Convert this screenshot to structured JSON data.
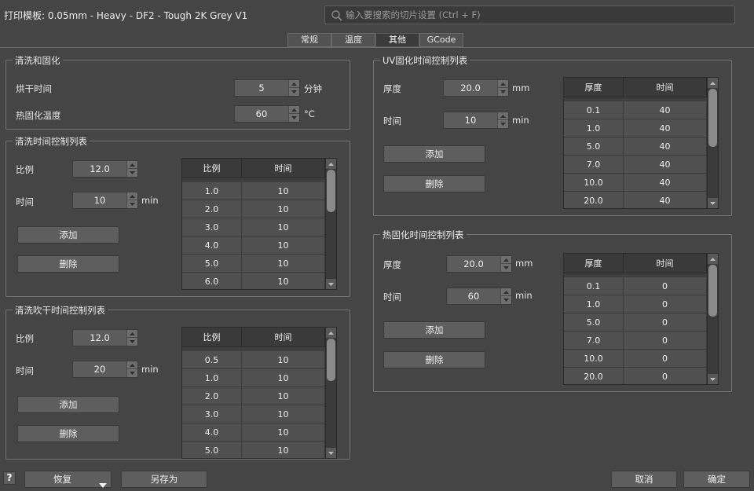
{
  "title": "打印模板: 0.05mm - Heavy - DF2 - Tough 2K Grey V1",
  "search": {
    "placeholder": "输入要搜索的切片设置 (Ctrl + F)"
  },
  "tabs": [
    {
      "label": "常规"
    },
    {
      "label": "温度"
    },
    {
      "label": "其他",
      "active": true
    },
    {
      "label": "GCode"
    }
  ],
  "wash_cure": {
    "title": "清洗和固化",
    "dry_time": {
      "label": "烘干时间",
      "value": "5",
      "unit": "分钟"
    },
    "heat_temp": {
      "label": "热固化温度",
      "value": "60",
      "unit": "°C"
    }
  },
  "wash_time_list": {
    "title": "清洗时间控制列表",
    "ratio": {
      "label": "比例",
      "value": "12.0"
    },
    "time": {
      "label": "时间",
      "value": "10",
      "unit": "min"
    },
    "add_label": "添加",
    "delete_label": "删除",
    "headers": [
      "比例",
      "时间"
    ],
    "rows": [
      [
        "1.0",
        "10"
      ],
      [
        "2.0",
        "10"
      ],
      [
        "3.0",
        "10"
      ],
      [
        "4.0",
        "10"
      ],
      [
        "5.0",
        "10"
      ],
      [
        "6.0",
        "10"
      ]
    ]
  },
  "blow_time_list": {
    "title": "清洗吹干时间控制列表",
    "ratio": {
      "label": "比例",
      "value": "12.0"
    },
    "time": {
      "label": "时间",
      "value": "20",
      "unit": "min"
    },
    "add_label": "添加",
    "delete_label": "删除",
    "headers": [
      "比例",
      "时间"
    ],
    "rows": [
      [
        "0.5",
        "10"
      ],
      [
        "1.0",
        "10"
      ],
      [
        "2.0",
        "10"
      ],
      [
        "3.0",
        "10"
      ],
      [
        "4.0",
        "10"
      ],
      [
        "5.0",
        "10"
      ]
    ]
  },
  "uv_time_list": {
    "title": "UV固化时间控制列表",
    "thickness": {
      "label": "厚度",
      "value": "20.0",
      "unit": "mm"
    },
    "time": {
      "label": "时间",
      "value": "10",
      "unit": "min"
    },
    "add_label": "添加",
    "delete_label": "删除",
    "headers": [
      "厚度",
      "时间"
    ],
    "rows": [
      [
        "0.1",
        "40"
      ],
      [
        "1.0",
        "40"
      ],
      [
        "5.0",
        "40"
      ],
      [
        "7.0",
        "40"
      ],
      [
        "10.0",
        "40"
      ],
      [
        "20.0",
        "40"
      ]
    ]
  },
  "heat_time_list": {
    "title": "热固化时间控制列表",
    "thickness": {
      "label": "厚度",
      "value": "20.0",
      "unit": "mm"
    },
    "time": {
      "label": "时间",
      "value": "60",
      "unit": "min"
    },
    "add_label": "添加",
    "delete_label": "删除",
    "headers": [
      "厚度",
      "时间"
    ],
    "rows": [
      [
        "0.1",
        "0"
      ],
      [
        "1.0",
        "0"
      ],
      [
        "5.0",
        "0"
      ],
      [
        "7.0",
        "0"
      ],
      [
        "10.0",
        "0"
      ],
      [
        "20.0",
        "0"
      ]
    ]
  },
  "footer": {
    "help": "?",
    "restore_label": "恢复",
    "save_as_label": "另存为",
    "cancel_label": "取消",
    "ok_label": "确定"
  },
  "colors": {
    "background": "#454545",
    "table_row": "#505050",
    "table_header": "#3a3a3a",
    "button": "#5e5e5e",
    "scroll_thumb": "#8a8a8a"
  }
}
